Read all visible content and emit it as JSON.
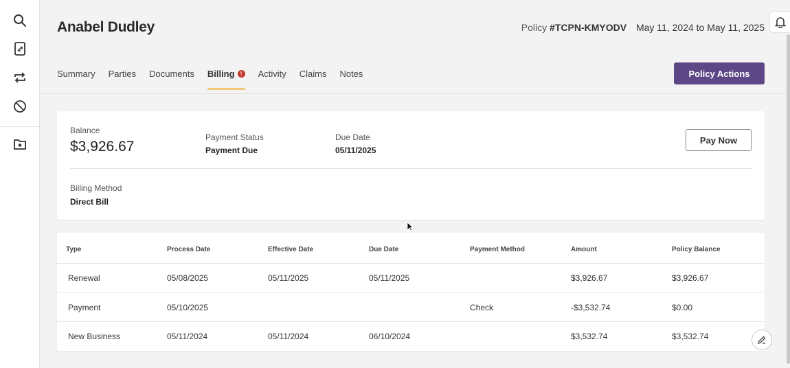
{
  "sidebar": {
    "icons": [
      "search-icon",
      "document-icon",
      "transfer-icon",
      "block-icon",
      "folder-icon"
    ]
  },
  "header": {
    "name": "Anabel Dudley",
    "policy_label": "Policy",
    "policy_number": "#TCPN-KMYODV",
    "dates": "May 11, 2024 to May 11, 2025"
  },
  "tabs": [
    {
      "label": "Summary"
    },
    {
      "label": "Parties"
    },
    {
      "label": "Documents"
    },
    {
      "label": "Billing",
      "active": true,
      "badge": "!"
    },
    {
      "label": "Activity"
    },
    {
      "label": "Claims"
    },
    {
      "label": "Notes"
    }
  ],
  "actions": {
    "policy_actions": "Policy Actions",
    "pay_now": "Pay Now"
  },
  "billing": {
    "balance_label": "Balance",
    "balance": "$3,926.67",
    "status_label": "Payment Status",
    "status": "Payment Due",
    "due_label": "Due Date",
    "due": "05/11/2025",
    "method_label": "Billing Method",
    "method": "Direct Bill"
  },
  "table": {
    "columns": [
      "Type",
      "Process Date",
      "Effective Date",
      "Due Date",
      "Payment Method",
      "Amount",
      "Policy Balance"
    ],
    "rows": [
      [
        "Renewal",
        "05/08/2025",
        "05/11/2025",
        "05/11/2025",
        "",
        "$3,926.67",
        "$3,926.67"
      ],
      [
        "Payment",
        "05/10/2025",
        "",
        "",
        "Check",
        "-$3,532.74",
        "$0.00"
      ],
      [
        "New Business",
        "05/11/2024",
        "05/11/2024",
        "06/10/2024",
        "",
        "$3,532.74",
        "$3,532.74"
      ]
    ]
  },
  "colors": {
    "accent": "#5e4786",
    "tab_underline": "#f2c77a",
    "badge": "#c0392b"
  }
}
